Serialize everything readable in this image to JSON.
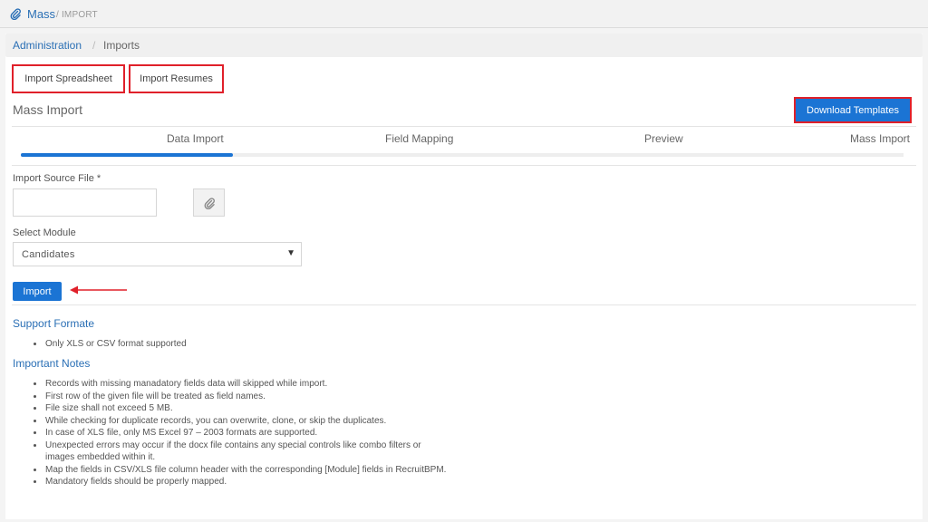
{
  "topbar": {
    "brand": "Mass",
    "sub": "/ IMPORT"
  },
  "breadcrumb": {
    "parent": "Administration",
    "separator": "/",
    "current": "Imports"
  },
  "tabs": {
    "spreadsheet": "Import Spreadsheet",
    "resumes": "Import Resumes"
  },
  "section_title": "Mass Import",
  "download_button": "Download Templates",
  "steps": [
    "Data Import",
    "Field Mapping",
    "Preview",
    "Mass Import"
  ],
  "progress": {
    "active_step": 1,
    "total_steps": 4
  },
  "form": {
    "file_label": "Import Source File *",
    "file_value": "",
    "module_label": "Select Module",
    "module_value": "Candidates",
    "caret": "▼",
    "import_button": "Import"
  },
  "support": {
    "title": "Support Formate",
    "items": [
      "Only XLS or CSV format supported"
    ]
  },
  "notes": {
    "title": "Important Notes",
    "items": [
      "Records with missing manadatory fields data will skipped while import.",
      "First row of the given file will be treated as field names.",
      "File size shall not exceed 5 MB.",
      "While checking for duplicate records, you can overwrite, clone, or skip the duplicates.",
      "In case of XLS file, only MS Excel 97 – 2003 formats are supported.",
      "Unexpected errors may occur if the docx file contains any special controls like combo filters or images embedded within it.",
      "Map the fields in CSV/XLS file column header with the corresponding [Module] fields in RecruitBPM.",
      "Mandatory fields should be properly mapped."
    ]
  },
  "colors": {
    "accent": "#1b74d4",
    "highlight": "#e0202a",
    "link": "#2a6fb5"
  },
  "icons": {
    "topbar": "paperclip-icon",
    "attach": "paperclip-icon",
    "annotation": "arrow-left-icon"
  }
}
